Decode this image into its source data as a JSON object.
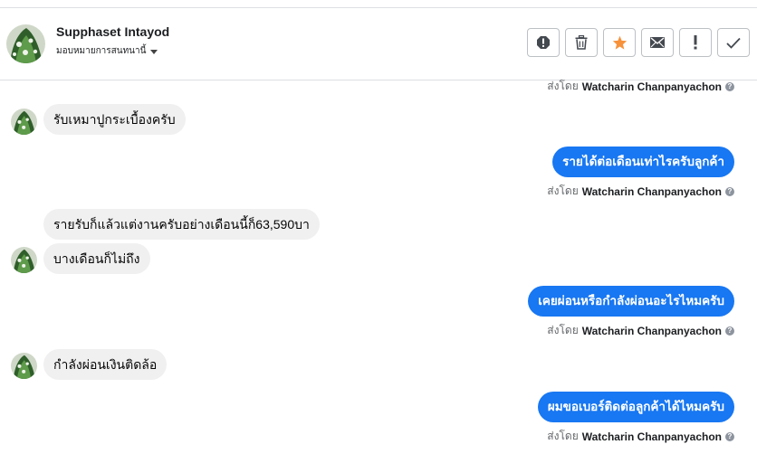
{
  "header": {
    "contact_name": "Supphaset Intayod",
    "assign_label": "มอบหมายการสนทนานี้"
  },
  "toolbar": {
    "buttons": [
      {
        "icon": "alert-octagon-icon"
      },
      {
        "icon": "trash-icon"
      },
      {
        "icon": "star-icon",
        "color": "#f7923b"
      },
      {
        "icon": "envelope-icon"
      },
      {
        "icon": "exclamation-icon"
      },
      {
        "icon": "checkmark-icon"
      }
    ]
  },
  "sent_by": {
    "prefix": "ส่งโดย",
    "name": "Watcharin Chanpanyachon"
  },
  "messages": {
    "m1": "รับเหมาปูกระเบื้องครับ",
    "m2": "รายได้ต่อเดือนเท่าไรครับลูกค้า",
    "m3": "รายรับก็แล้วแต่งานครับอย่างเดือนนี้ก็63,590บา",
    "m4": "บางเดือนก็ไม่ถึง",
    "m5": "เคยผ่อนหรือกำลังผ่อนอะไรไหมครับ",
    "m6": "กำลังผ่อนเงินติดล้อ",
    "m7": "ผมขอเบอร์ติดต่อลูกค้าได้ไหมครับ"
  },
  "colors": {
    "outgoing_bubble": "#1877f2",
    "incoming_bubble": "#f0f0f0",
    "star": "#f7923b"
  }
}
